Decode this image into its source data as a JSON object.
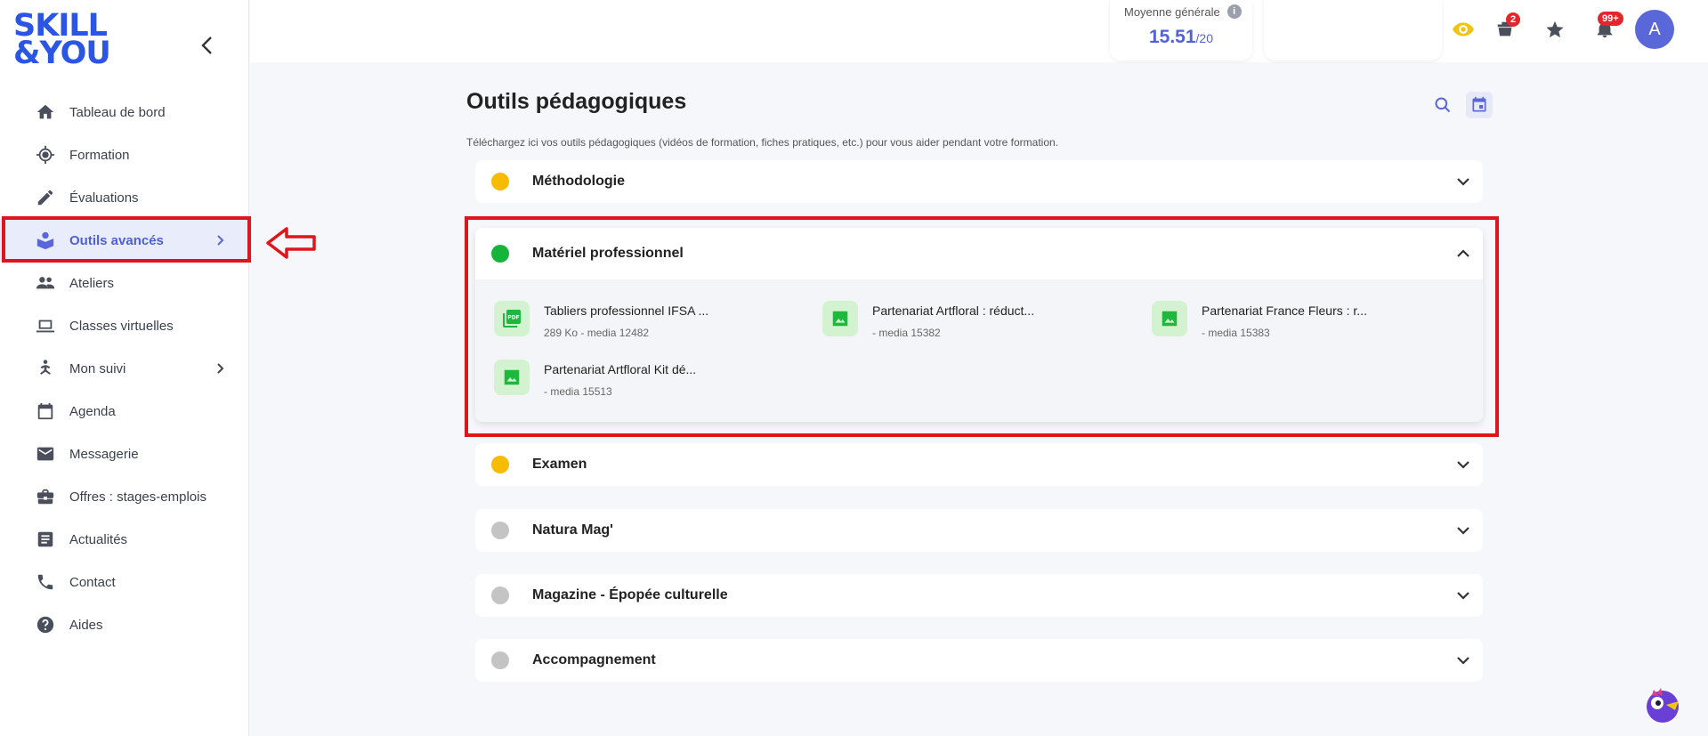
{
  "logo": {
    "line1": "SKILL",
    "line2": "&YOU"
  },
  "sidebar": {
    "items": [
      {
        "label": "Tableau de bord",
        "icon": "home-icon"
      },
      {
        "label": "Formation",
        "icon": "target-icon"
      },
      {
        "label": "Évaluations",
        "icon": "pencil-icon"
      },
      {
        "label": "Outils avancés",
        "icon": "book-user-icon",
        "active": true
      },
      {
        "label": "Ateliers",
        "icon": "group-icon"
      },
      {
        "label": "Classes virtuelles",
        "icon": "laptop-icon"
      },
      {
        "label": "Mon suivi",
        "icon": "person-yoga-icon"
      },
      {
        "label": "Agenda",
        "icon": "calendar-icon"
      },
      {
        "label": "Messagerie",
        "icon": "mail-icon"
      },
      {
        "label": "Offres : stages-emplois",
        "icon": "briefcase-icon"
      },
      {
        "label": "Actualités",
        "icon": "article-icon"
      },
      {
        "label": "Contact",
        "icon": "phone-icon"
      },
      {
        "label": "Aides",
        "icon": "help-icon"
      }
    ]
  },
  "topbar": {
    "average_label": "Moyenne générale",
    "average_value": "15.51",
    "average_scale": "/20",
    "cart_badge": "2",
    "notif_badge": "99+",
    "avatar_letter": "A"
  },
  "page": {
    "title": "Outils pédagogiques",
    "description": "Téléchargez ici vos outils pédagogiques (vidéos de formation, fiches pratiques, etc.) pour vous aider pendant votre formation."
  },
  "sections": [
    {
      "title": "Méthodologie",
      "color": "#f7bb00"
    },
    {
      "title": "Matériel professionnel",
      "color": "#14b53a",
      "open": true
    },
    {
      "title": "Examen",
      "color": "#f7bb00"
    },
    {
      "title": "Natura Mag'",
      "color": "#c4c4c4"
    },
    {
      "title": "Magazine - Épopée culturelle",
      "color": "#c4c4c4"
    },
    {
      "title": "Accompagnement",
      "color": "#c4c4c4"
    }
  ],
  "files": [
    {
      "name": "Tabliers professionnel IFSA ...",
      "meta": "289 Ko - media 12482",
      "icon": "pdf-icon"
    },
    {
      "name": "Partenariat Artfloral : réduct...",
      "meta": "- media 15382",
      "icon": "image-icon"
    },
    {
      "name": "Partenariat France Fleurs : r...",
      "meta": "- media 15383",
      "icon": "image-icon"
    },
    {
      "name": "Partenariat Artfloral Kit dé...",
      "meta": "- media 15513",
      "icon": "image-icon"
    }
  ],
  "colors": {
    "accent": "#5967d8",
    "brand": "#2a55e5",
    "annotation": "#e0141b"
  }
}
